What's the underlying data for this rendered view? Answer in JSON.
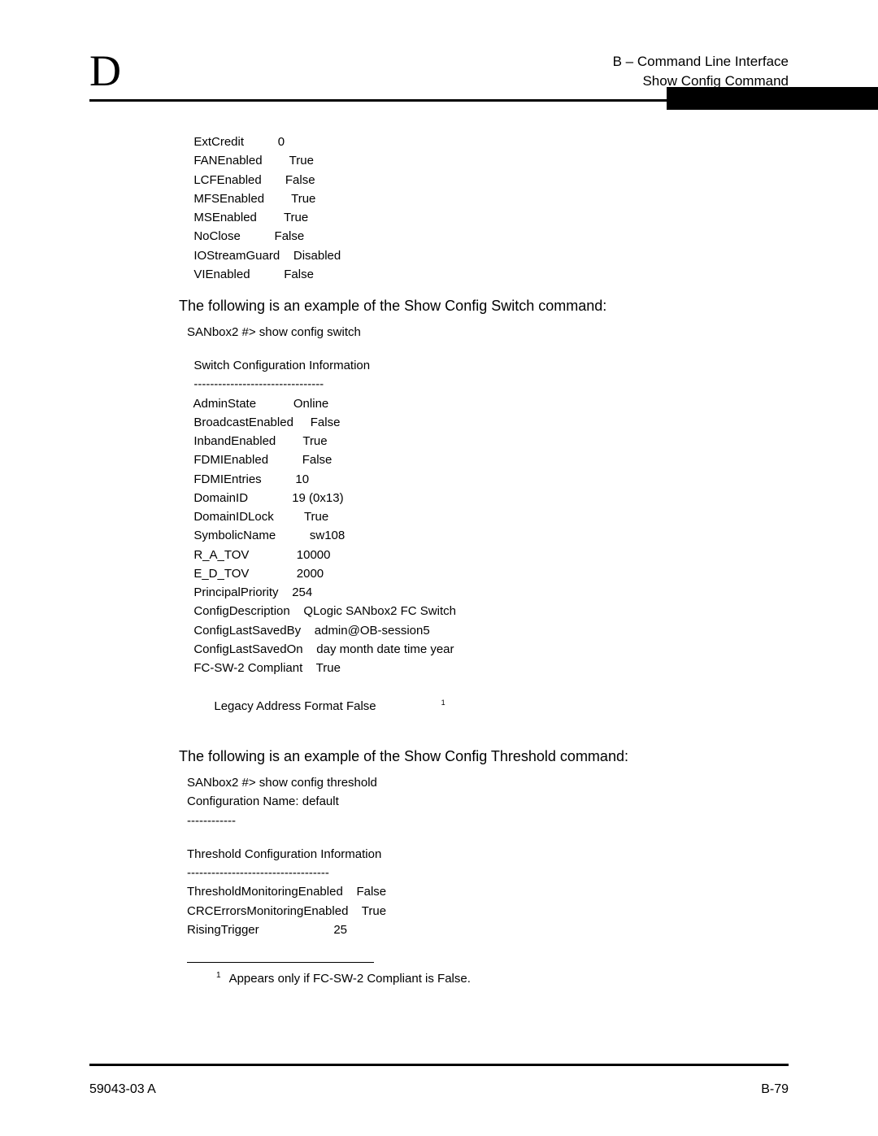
{
  "header": {
    "letter": "D",
    "line1": "B – Command Line Interface",
    "line2": "Show Config Command"
  },
  "block1": [
    {
      "key": "ExtCredit",
      "value": "0",
      "pad": "          "
    },
    {
      "key": "FANEnabled",
      "value": "True",
      "pad": "        "
    },
    {
      "key": "LCFEnabled",
      "value": "False",
      "pad": "       "
    },
    {
      "key": "MFSEnabled",
      "value": "True",
      "pad": "        "
    },
    {
      "key": "MSEnabled",
      "value": "True",
      "pad": "        "
    },
    {
      "key": "NoClose",
      "value": "False",
      "pad": "          "
    },
    {
      "key": "IOStreamGuard",
      "value": "Disabled",
      "pad": "    "
    },
    {
      "key": "VIEnabled",
      "value": "False",
      "pad": "          "
    }
  ],
  "heading2": "The following is an example of the Show Config Switch command:",
  "block2_cmd": "SANbox2 #> show config switch",
  "block2_title": "  Switch Configuration Information",
  "block2_sep": "  --------------------------------",
  "block2_rows": [
    {
      "key": "AdminState",
      "value": "Online",
      "pad": "           "
    },
    {
      "key": "BroadcastEnabled",
      "value": "False",
      "pad": "     "
    },
    {
      "key": "InbandEnabled",
      "value": "True",
      "pad": "        "
    },
    {
      "key": "FDMIEnabled",
      "value": "False",
      "pad": "          "
    },
    {
      "key": "FDMIEntries",
      "value": "10",
      "pad": "          "
    },
    {
      "key": "DomainID",
      "value": "19 (0x13)",
      "pad": "             "
    },
    {
      "key": "DomainIDLock",
      "value": "True",
      "pad": "         "
    },
    {
      "key": "SymbolicName",
      "value": "sw108",
      "pad": "          "
    },
    {
      "key": "R_A_TOV",
      "value": "10000",
      "pad": "              "
    },
    {
      "key": "E_D_TOV",
      "value": "2000",
      "pad": "              "
    },
    {
      "key": "PrincipalPriority",
      "value": "254",
      "pad": "    "
    },
    {
      "key": "ConfigDescription",
      "value": "QLogic SANbox2 FC Switch",
      "pad": "    "
    },
    {
      "key": "ConfigLastSavedBy",
      "value": "admin@OB-session5",
      "pad": "    "
    },
    {
      "key": "ConfigLastSavedOn",
      "value": "day month date time year",
      "pad": "    "
    },
    {
      "key": "FC-SW-2 Compliant",
      "value": "True",
      "pad": "    "
    }
  ],
  "block2_last": {
    "key": "Legacy Address Format",
    "value": "False",
    "note": "1"
  },
  "heading3": "The following is an example of the Show Config Threshold command:",
  "block3_cmd": "SANbox2 #> show config threshold",
  "block3_cfg": "Configuration Name: default",
  "block3_sep1": "------------",
  "block3_title": "Threshold Configuration Information",
  "block3_sep2": "-----------------------------------",
  "block3_rows": [
    {
      "key": "ThresholdMonitoringEnabled",
      "value": "False",
      "pad": "    "
    },
    {
      "key": "CRCErrorsMonitoringEnabled",
      "value": "True",
      "pad": "    "
    },
    {
      "key": "RisingTrigger",
      "value": "25",
      "pad": "                      "
    }
  ],
  "footnote": {
    "num": "1",
    "text": "Appears only if FC-SW-2 Compliant is False."
  },
  "footer": {
    "left": "59043-03  A",
    "right": "B-79"
  }
}
